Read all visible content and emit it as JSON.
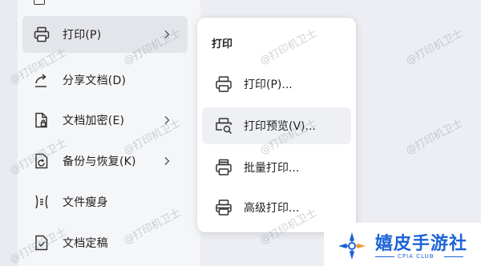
{
  "main_menu": {
    "items": [
      {
        "label": "打印(P)",
        "icon": "printer-icon",
        "has_submenu": true,
        "active": true
      },
      {
        "label": "分享文档(D)",
        "icon": "share-icon",
        "has_submenu": false
      },
      {
        "label": "文档加密(E)",
        "icon": "document-lock-icon",
        "has_submenu": true
      },
      {
        "label": "备份与恢复(K)",
        "icon": "backup-restore-icon",
        "has_submenu": true
      },
      {
        "label": "文件瘦身",
        "icon": "compress-file-icon",
        "has_submenu": false
      },
      {
        "label": "文档定稿",
        "icon": "finalize-document-icon",
        "has_submenu": false
      }
    ]
  },
  "submenu": {
    "title": "打印",
    "items": [
      {
        "label": "打印(P)...",
        "icon": "printer-icon"
      },
      {
        "label": "打印预览(V)...",
        "icon": "print-preview-icon",
        "hover": true
      },
      {
        "label": "批量打印...",
        "icon": "batch-print-icon"
      },
      {
        "label": "高级打印...",
        "icon": "advanced-print-icon"
      }
    ]
  },
  "watermark_text": "@打印机卫士",
  "logo": {
    "name": "嬉皮手游社",
    "sub": "CPIA CLUB",
    "colors": {
      "blue": "#1d63d8",
      "orange": "#f29a2e"
    }
  }
}
